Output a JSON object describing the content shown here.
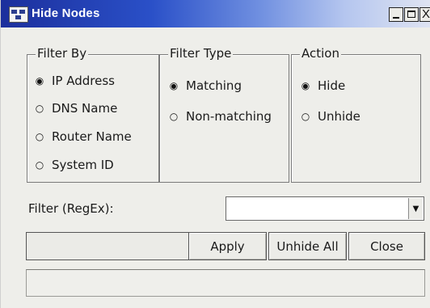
{
  "window": {
    "title": "Hide Nodes",
    "close_glyph": "X"
  },
  "filter_by": {
    "legend": "Filter By",
    "options": [
      {
        "label": "IP Address",
        "selected": true
      },
      {
        "label": "DNS Name",
        "selected": false
      },
      {
        "label": "Router Name",
        "selected": false
      },
      {
        "label": "System ID",
        "selected": false
      }
    ]
  },
  "filter_type": {
    "legend": "Filter Type",
    "options": [
      {
        "label": "Matching",
        "selected": true
      },
      {
        "label": "Non-matching",
        "selected": false
      }
    ]
  },
  "action": {
    "legend": "Action",
    "options": [
      {
        "label": "Hide",
        "selected": true
      },
      {
        "label": "Unhide",
        "selected": false
      }
    ]
  },
  "filter_regex": {
    "label": "Filter (RegEx):",
    "value": ""
  },
  "buttons": {
    "apply": "Apply",
    "unhide_all": "Unhide All",
    "close": "Close"
  },
  "radio_glyphs": {
    "selected": "◉",
    "unselected": "○"
  },
  "colors": {
    "titlebar_start": "#1c2f9c",
    "window_bg": "#eeeeea"
  }
}
